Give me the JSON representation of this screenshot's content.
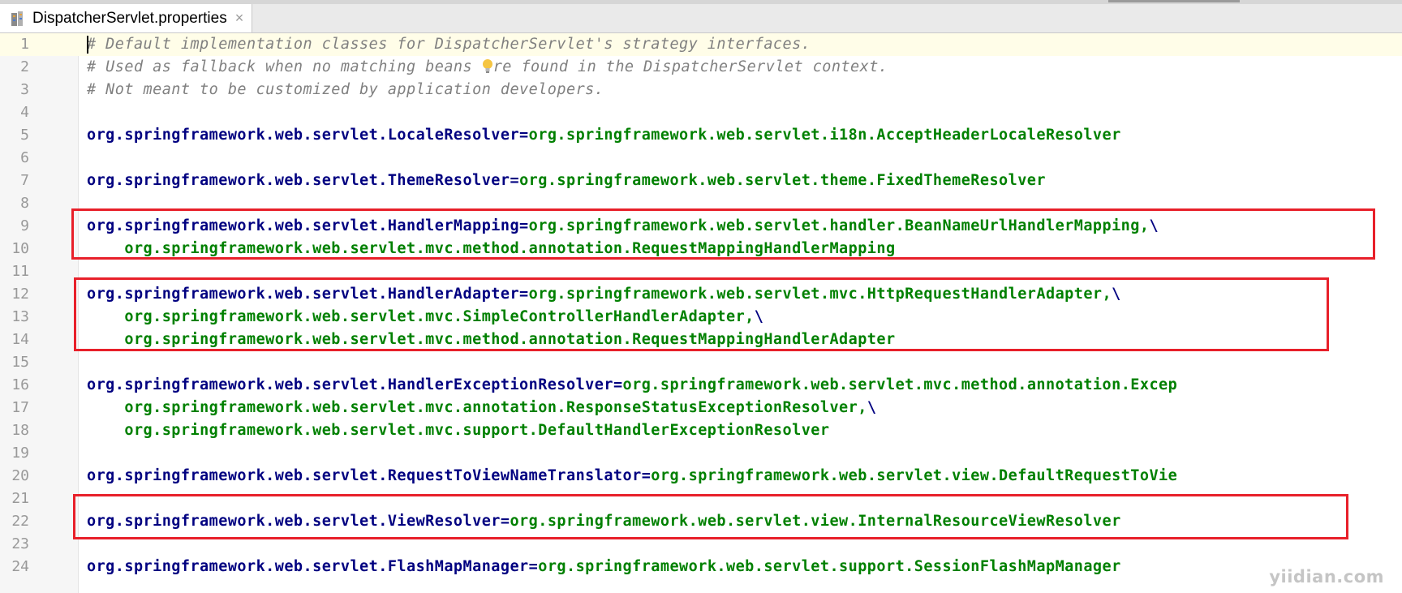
{
  "tab": {
    "label": "DispatcherServlet.properties",
    "close_glyph": "×",
    "file_icon": "properties-file-icon"
  },
  "lines": [
    {
      "number": "1",
      "comment": "# Default implementation classes for DispatcherServlet's strategy interfaces."
    },
    {
      "number": "2",
      "comment_before": "# Used as fallback when no matching beans ",
      "comment_after": "re found in the DispatcherServlet context.",
      "icon": "lightbulb-icon"
    },
    {
      "number": "3",
      "comment": "# Not meant to be customized by application developers."
    },
    {
      "number": "4"
    },
    {
      "number": "5",
      "key": "org.springframework.web.servlet.LocaleResolver",
      "value": "org.springframework.web.servlet.i18n.AcceptHeaderLocaleResolver"
    },
    {
      "number": "6"
    },
    {
      "number": "7",
      "key": "org.springframework.web.servlet.ThemeResolver",
      "value": "org.springframework.web.servlet.theme.FixedThemeResolver"
    },
    {
      "number": "8"
    },
    {
      "number": "9",
      "key": "org.springframework.web.servlet.HandlerMapping",
      "value": "org.springframework.web.servlet.handler.BeanNameUrlHandlerMapping,",
      "continuation": "\\"
    },
    {
      "number": "10",
      "value": "org.springframework.web.servlet.mvc.method.annotation.RequestMappingHandlerMapping"
    },
    {
      "number": "11"
    },
    {
      "number": "12",
      "key": "org.springframework.web.servlet.HandlerAdapter",
      "value": "org.springframework.web.servlet.mvc.HttpRequestHandlerAdapter,",
      "continuation": "\\"
    },
    {
      "number": "13",
      "value": "org.springframework.web.servlet.mvc.SimpleControllerHandlerAdapter,",
      "continuation": "\\"
    },
    {
      "number": "14",
      "value": "org.springframework.web.servlet.mvc.method.annotation.RequestMappingHandlerAdapter"
    },
    {
      "number": "15"
    },
    {
      "number": "16",
      "key": "org.springframework.web.servlet.HandlerExceptionResolver",
      "value": "org.springframework.web.servlet.mvc.method.annotation.Excep"
    },
    {
      "number": "17",
      "value": "org.springframework.web.servlet.mvc.annotation.ResponseStatusExceptionResolver,",
      "continuation": "\\"
    },
    {
      "number": "18",
      "value": "org.springframework.web.servlet.mvc.support.DefaultHandlerExceptionResolver"
    },
    {
      "number": "19"
    },
    {
      "number": "20",
      "key": "org.springframework.web.servlet.RequestToViewNameTranslator",
      "value": "org.springframework.web.servlet.view.DefaultRequestToVie"
    },
    {
      "number": "21"
    },
    {
      "number": "22",
      "key": "org.springframework.web.servlet.ViewResolver",
      "value": "org.springframework.web.servlet.view.InternalResourceViewResolver"
    },
    {
      "number": "23"
    },
    {
      "number": "24",
      "key": "org.springframework.web.servlet.FlashMapManager",
      "value": "org.springframework.web.servlet.support.SessionFlashMapManager"
    }
  ],
  "watermark": "yiidian.com",
  "colors": {
    "comment": "#808080",
    "key": "#000080",
    "value": "#008000",
    "highlight": "#e8202a",
    "current_line": "#fffde8"
  }
}
